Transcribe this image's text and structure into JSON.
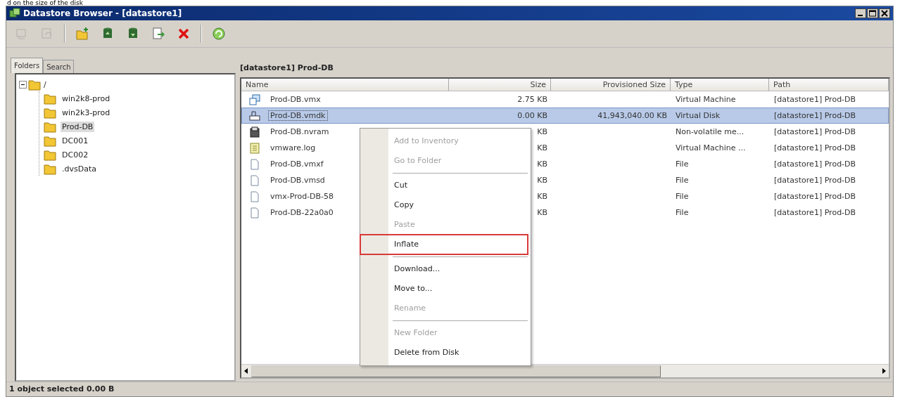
{
  "caption": "d on the size of the disk",
  "window": {
    "title": "Datastore Browser - [datastore1]"
  },
  "toolbar": [
    {
      "kind": "vm-add",
      "disabled": true
    },
    {
      "kind": "go-folder",
      "disabled": true
    },
    {
      "kind": "new-folder",
      "disabled": false
    },
    {
      "kind": "upload",
      "disabled": false
    },
    {
      "kind": "download",
      "disabled": false
    },
    {
      "kind": "move",
      "disabled": false
    },
    {
      "kind": "delete",
      "disabled": false
    },
    {
      "kind": "refresh",
      "disabled": false
    }
  ],
  "tabs": [
    {
      "label": "Folders",
      "selected": true
    },
    {
      "label": "Search",
      "selected": false
    }
  ],
  "tree": {
    "label": "/",
    "expanded": true,
    "selected": false,
    "children": [
      {
        "label": "win2k8-prod",
        "selected": false
      },
      {
        "label": "win2k3-prod",
        "selected": false
      },
      {
        "label": "Prod-DB",
        "selected": true
      },
      {
        "label": "DC001",
        "selected": false
      },
      {
        "label": "DC002",
        "selected": false
      },
      {
        "label": ".dvsData",
        "selected": false
      }
    ]
  },
  "breadcrumb": "[datastore1] Prod-DB",
  "table": {
    "columns": [
      "Name",
      "Size",
      "Provisioned Size",
      "Type",
      "Path"
    ],
    "rows": [
      {
        "kind": "vm",
        "name": "Prod-DB.vmx",
        "size": "2.75 KB",
        "provisioned": "",
        "type": "Virtual Machine",
        "path": "[datastore1] Prod-DB",
        "selected": false
      },
      {
        "kind": "disk",
        "name": "Prod-DB.vmdk",
        "size": "0.00 KB",
        "provisioned": "41,943,040.00 KB",
        "type": "Virtual Disk",
        "path": "[datastore1] Prod-DB",
        "selected": true
      },
      {
        "kind": "nvram",
        "name": "Prod-DB.nvram",
        "size": "KB",
        "provisioned": "",
        "type": "Non-volatile me...",
        "path": "[datastore1] Prod-DB",
        "selected": false
      },
      {
        "kind": "log",
        "name": "vmware.log",
        "size": "KB",
        "provisioned": "",
        "type": "Virtual Machine ...",
        "path": "[datastore1] Prod-DB",
        "selected": false
      },
      {
        "kind": "file",
        "name": "Prod-DB.vmxf",
        "size": "KB",
        "provisioned": "",
        "type": "File",
        "path": "[datastore1] Prod-DB",
        "selected": false
      },
      {
        "kind": "file",
        "name": "Prod-DB.vmsd",
        "size": "KB",
        "provisioned": "",
        "type": "File",
        "path": "[datastore1] Prod-DB",
        "selected": false
      },
      {
        "kind": "file",
        "name": "vmx-Prod-DB-58",
        "size": "KB",
        "provisioned": "",
        "type": "File",
        "path": "[datastore1] Prod-DB",
        "selected": false
      },
      {
        "kind": "file",
        "name": "Prod-DB-22a0a0",
        "size": "KB",
        "provisioned": "",
        "type": "File",
        "path": "[datastore1] Prod-DB",
        "selected": false
      }
    ]
  },
  "context_menu": [
    {
      "label": "Add to Inventory",
      "disabled": true,
      "marked": false,
      "separator_after": false
    },
    {
      "label": "Go to Folder",
      "disabled": true,
      "marked": false,
      "separator_after": true
    },
    {
      "label": "Cut",
      "disabled": false,
      "marked": false,
      "separator_after": false
    },
    {
      "label": "Copy",
      "disabled": false,
      "marked": false,
      "separator_after": false
    },
    {
      "label": "Paste",
      "disabled": true,
      "marked": false,
      "separator_after": false
    },
    {
      "label": "Inflate",
      "disabled": false,
      "marked": true,
      "separator_after": true
    },
    {
      "label": "Download...",
      "disabled": false,
      "marked": false,
      "separator_after": false
    },
    {
      "label": "Move to...",
      "disabled": false,
      "marked": false,
      "separator_after": false
    },
    {
      "label": "Rename",
      "disabled": true,
      "marked": false,
      "separator_after": true
    },
    {
      "label": "New Folder",
      "disabled": true,
      "marked": false,
      "separator_after": false
    },
    {
      "label": "Delete from Disk",
      "disabled": false,
      "marked": false,
      "separator_after": false
    }
  ],
  "status_bar": "1 object selected 0.00 B"
}
